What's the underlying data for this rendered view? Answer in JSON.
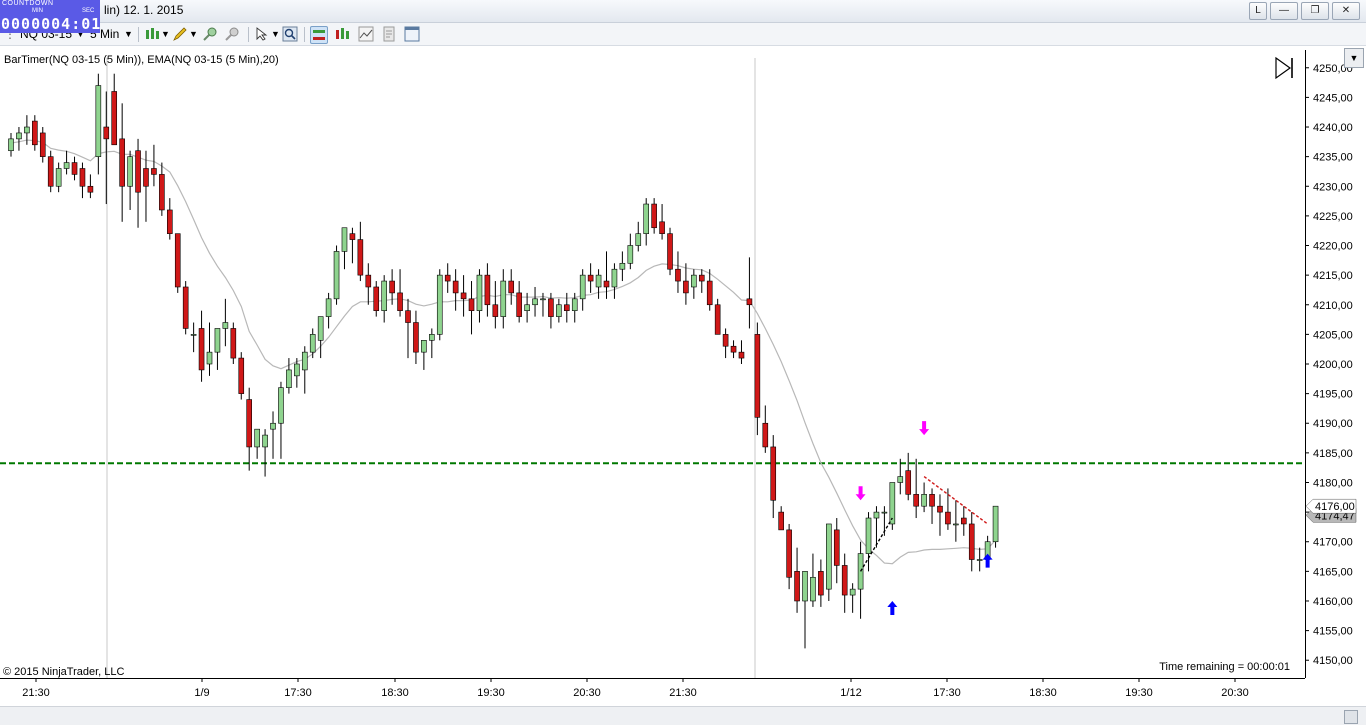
{
  "window": {
    "title": "lin)  12. 1. 2015",
    "buttons": [
      "L",
      "—",
      "❐",
      "✕"
    ]
  },
  "countdown": {
    "label": "COUNTDOWN",
    "min_label": "MIN",
    "sec_label": "SEC",
    "value": "0000004:01"
  },
  "toolbar": {
    "instrument": "NQ 03-15",
    "interval": "5 Min"
  },
  "chart": {
    "indicator_label": "BarTimer(NQ 03-15 (5 Min)), EMA(NQ 03-15 (5 Min),20)",
    "copyright": "© 2015 NinjaTrader, LLC",
    "time_remaining": "Time remaining = 00:00:01",
    "last_price_label": "4176,00",
    "ema_price_label": "4174,47"
  },
  "colors": {
    "up": "#8fd48f",
    "down": "#d01818",
    "ema": "#b8b8b8",
    "hline": "#007800",
    "sell_arrow": "#ff00ff",
    "buy_arrow": "#0000ff"
  },
  "chart_data": {
    "type": "candlestick",
    "y_ticks": [
      "4250,00",
      "4245,00",
      "4240,00",
      "4235,00",
      "4230,00",
      "4225,00",
      "4220,00",
      "4215,00",
      "4210,00",
      "4205,00",
      "4200,00",
      "4195,00",
      "4190,00",
      "4185,00",
      "4180,00",
      "4175,00",
      "4170,00",
      "4165,00",
      "4160,00",
      "4155,00",
      "4150,00"
    ],
    "x_ticks": [
      "21:30",
      "1/9",
      "17:30",
      "18:30",
      "19:30",
      "20:30",
      "21:30",
      "1/12",
      "17:30",
      "18:30",
      "19:30",
      "20:30"
    ],
    "ylim": [
      4147,
      4253
    ],
    "horizontal_line": 4183.25,
    "ohlc": [
      [
        4236,
        4239,
        4235,
        4238
      ],
      [
        4238,
        4240,
        4236,
        4239
      ],
      [
        4239,
        4242,
        4237,
        4240
      ],
      [
        4241,
        4242,
        4236,
        4237
      ],
      [
        4239,
        4240,
        4234,
        4235
      ],
      [
        4235,
        4236,
        4229,
        4230
      ],
      [
        4230,
        4234,
        4229,
        4233
      ],
      [
        4233,
        4236,
        4232,
        4234
      ],
      [
        4234,
        4235,
        4231,
        4232
      ],
      [
        4233,
        4234,
        4228,
        4230
      ],
      [
        4230,
        4232,
        4228,
        4229
      ],
      [
        4235,
        4249,
        4232,
        4247
      ],
      [
        4240,
        4246,
        4227,
        4238
      ],
      [
        4246,
        4249,
        4237,
        4237
      ],
      [
        4238,
        4244,
        4224,
        4230
      ],
      [
        4230,
        4236,
        4226,
        4235
      ],
      [
        4236,
        4238,
        4223,
        4229
      ],
      [
        4233,
        4236,
        4224,
        4230
      ],
      [
        4233,
        4237,
        4230,
        4232
      ],
      [
        4232,
        4234,
        4225,
        4226
      ],
      [
        4226,
        4228,
        4221,
        4222
      ],
      [
        4222,
        4222,
        4212,
        4213
      ],
      [
        4213,
        4214,
        4205,
        4206
      ],
      [
        4205,
        4207,
        4202,
        4205
      ],
      [
        4206,
        4209,
        4197,
        4199
      ],
      [
        4200,
        4207,
        4198,
        4202
      ],
      [
        4202,
        4206,
        4199,
        4206
      ],
      [
        4206,
        4211,
        4203,
        4207
      ],
      [
        4206,
        4207,
        4200,
        4201
      ],
      [
        4201,
        4202,
        4194,
        4195
      ],
      [
        4194,
        4196,
        4182,
        4186
      ],
      [
        4186,
        4189,
        4184,
        4189
      ],
      [
        4186,
        4189,
        4181,
        4188
      ],
      [
        4189,
        4192,
        4184,
        4190
      ],
      [
        4190,
        4197,
        4184,
        4196
      ],
      [
        4196,
        4201,
        4195,
        4199
      ],
      [
        4198,
        4201,
        4196,
        4200
      ],
      [
        4199,
        4203,
        4195,
        4202
      ],
      [
        4202,
        4206,
        4201,
        4205
      ],
      [
        4204,
        4208,
        4201,
        4208
      ],
      [
        4208,
        4212,
        4206,
        4211
      ],
      [
        4211,
        4220,
        4210,
        4219
      ],
      [
        4219,
        4223,
        4216,
        4223
      ],
      [
        4222,
        4223,
        4217,
        4221
      ],
      [
        4221,
        4224,
        4214,
        4215
      ],
      [
        4215,
        4217,
        4210,
        4213
      ],
      [
        4213,
        4214,
        4208,
        4209
      ],
      [
        4209,
        4215,
        4207,
        4214
      ],
      [
        4214,
        4216,
        4210,
        4212
      ],
      [
        4212,
        4216,
        4208,
        4209
      ],
      [
        4209,
        4211,
        4201,
        4207
      ],
      [
        4207,
        4209,
        4200,
        4202
      ],
      [
        4202,
        4204,
        4199,
        4204
      ],
      [
        4204,
        4206,
        4201,
        4205
      ],
      [
        4205,
        4216,
        4204,
        4215
      ],
      [
        4215,
        4217,
        4212,
        4214
      ],
      [
        4214,
        4216,
        4209,
        4212
      ],
      [
        4212,
        4215,
        4208,
        4211
      ],
      [
        4211,
        4214,
        4205,
        4209
      ],
      [
        4209,
        4216,
        4207,
        4215
      ],
      [
        4215,
        4217,
        4208,
        4210
      ],
      [
        4210,
        4214,
        4206,
        4208
      ],
      [
        4208,
        4216,
        4206,
        4214
      ],
      [
        4214,
        4216,
        4210,
        4212
      ],
      [
        4212,
        4214,
        4207,
        4208
      ],
      [
        4209,
        4212,
        4207,
        4210
      ],
      [
        4210,
        4213,
        4208,
        4211
      ],
      [
        4211,
        4212,
        4208,
        4211
      ],
      [
        4211,
        4212,
        4206,
        4208
      ],
      [
        4208,
        4211,
        4207,
        4210
      ],
      [
        4210,
        4212,
        4207,
        4209
      ],
      [
        4209,
        4212,
        4207,
        4211
      ],
      [
        4211,
        4216,
        4209,
        4215
      ],
      [
        4215,
        4217,
        4212,
        4214
      ],
      [
        4213,
        4216,
        4211,
        4215
      ],
      [
        4214,
        4219,
        4211,
        4213
      ],
      [
        4213,
        4217,
        4211,
        4216
      ],
      [
        4216,
        4219,
        4214,
        4217
      ],
      [
        4217,
        4222,
        4216,
        4220
      ],
      [
        4220,
        4224,
        4219,
        4222
      ],
      [
        4222,
        4228,
        4220,
        4227
      ],
      [
        4227,
        4228,
        4222,
        4223
      ],
      [
        4224,
        4227,
        4221,
        4222
      ],
      [
        4222,
        4223,
        4215,
        4216
      ],
      [
        4216,
        4219,
        4212,
        4214
      ],
      [
        4214,
        4217,
        4210,
        4212
      ],
      [
        4213,
        4216,
        4211,
        4215
      ],
      [
        4215,
        4216,
        4212,
        4214
      ],
      [
        4214,
        4216,
        4209,
        4210
      ],
      [
        4210,
        4211,
        4205,
        4205
      ],
      [
        4205,
        4206,
        4201,
        4203
      ],
      [
        4203,
        4204,
        4201,
        4202
      ],
      [
        4202,
        4204,
        4200,
        4201
      ],
      [
        4211,
        4218,
        4206,
        4210
      ],
      [
        4205,
        4207,
        4188,
        4191
      ],
      [
        4190,
        4193,
        4185,
        4186
      ],
      [
        4186,
        4188,
        4174,
        4177
      ],
      [
        4175,
        4176,
        4172,
        4172
      ],
      [
        4172,
        4173,
        4162,
        4164
      ],
      [
        4165,
        4169,
        4158,
        4160
      ],
      [
        4160,
        4165,
        4152,
        4165
      ],
      [
        4160,
        4168,
        4159,
        4164
      ],
      [
        4165,
        4167,
        4159,
        4161
      ],
      [
        4162,
        4173,
        4160,
        4173
      ],
      [
        4172,
        4174,
        4163,
        4166
      ],
      [
        4166,
        4168,
        4158,
        4161
      ],
      [
        4161,
        4163,
        4158,
        4162
      ],
      [
        4162,
        4170,
        4157,
        4168
      ],
      [
        4168,
        4175,
        4165,
        4174
      ],
      [
        4174,
        4176,
        4169,
        4175
      ],
      [
        4175,
        4176,
        4171,
        4175
      ],
      [
        4173,
        4180,
        4172,
        4180
      ],
      [
        4180,
        4184,
        4178,
        4181
      ],
      [
        4182,
        4185,
        4177,
        4178
      ],
      [
        4178,
        4184,
        4174,
        4176
      ],
      [
        4176,
        4180,
        4175,
        4178
      ],
      [
        4178,
        4179,
        4173,
        4176
      ],
      [
        4176,
        4178,
        4171,
        4175
      ],
      [
        4175,
        4179,
        4172,
        4173
      ],
      [
        4173,
        4177,
        4170,
        4173
      ],
      [
        4174,
        4176,
        4171,
        4173
      ],
      [
        4173,
        4175,
        4165,
        4167
      ],
      [
        4167,
        4169,
        4165,
        4167
      ],
      [
        4167,
        4171,
        4166,
        4170
      ],
      [
        4170,
        4176,
        4169,
        4176
      ]
    ],
    "ema": [
      4237.3,
      4237.5,
      4237.8,
      4237.7,
      4237.4,
      4236.4,
      4236.1,
      4235.9,
      4235.5,
      4234.9,
      4234.3,
      4235.5,
      4235.8,
      4235.9,
      4235.4,
      4235.4,
      4234.9,
      4234.4,
      4234.2,
      4233.4,
      4232.4,
      4230.1,
      4227.4,
      4224.4,
      4221.3,
      4218.7,
      4216.5,
      4214.6,
      4212.4,
      4209.7,
      4205.5,
      4203.2,
      4200.8,
      4199.7,
      4199.2,
      4199.8,
      4200.4,
      4200.8,
      4201.7,
      4203.0,
      4204.5,
      4206.3,
      4208.1,
      4209.7,
      4210.5,
      4210.5,
      4210.6,
      4210.7,
      4210.9,
      4211.0,
      4210.7,
      4210.1,
      4209.8,
      4210.1,
      4210.5,
      4210.5,
      4210.7,
      4210.7,
      4210.8,
      4211.4,
      4211.6,
      4211.4,
      4211.7,
      4211.7,
      4211.3,
      4211.3,
      4211.3,
      4211.4,
      4211.1,
      4211.2,
      4211.1,
      4211.2,
      4211.6,
      4211.7,
      4212.1,
      4212.2,
      4212.6,
      4213.1,
      4213.7,
      4214.6,
      4215.8,
      4216.5,
      4216.9,
      4216.8,
      4216.6,
      4216.2,
      4216.0,
      4215.9,
      4215.3,
      4214.3,
      4213.2,
      4212.1,
      4210.8,
      4210.7,
      4208.5,
      4206.0,
      4203.3,
      4200.4,
      4197.2,
      4193.8,
      4190.1,
      4186.6,
      4183.3,
      4180.9,
      4178.2,
      4175.4,
      4172.7,
      4170.3,
      4168.8,
      4167.7,
      4166.4,
      4166.3,
      4167.4,
      4168.2,
      4168.3,
      4168.6,
      4168.7,
      4168.7,
      4168.8,
      4168.9,
      4169.0,
      4168.9,
      4168.7,
      4168.8,
      4170.3
    ],
    "markers": [
      {
        "type": "sell",
        "bar": 107,
        "price": 4177
      },
      {
        "type": "sell",
        "bar": 115,
        "price": 4188
      },
      {
        "type": "buy",
        "bar": 111,
        "price": 4160
      },
      {
        "type": "buy",
        "bar": 123,
        "price": 4168
      }
    ],
    "trade_lines": [
      {
        "from_bar": 107,
        "from_price": 4165,
        "to_bar": 111,
        "to_price": 4174,
        "color": "#000000"
      },
      {
        "from_bar": 115,
        "from_price": 4181,
        "to_bar": 123,
        "to_price": 4173,
        "color": "#d01818"
      }
    ]
  }
}
